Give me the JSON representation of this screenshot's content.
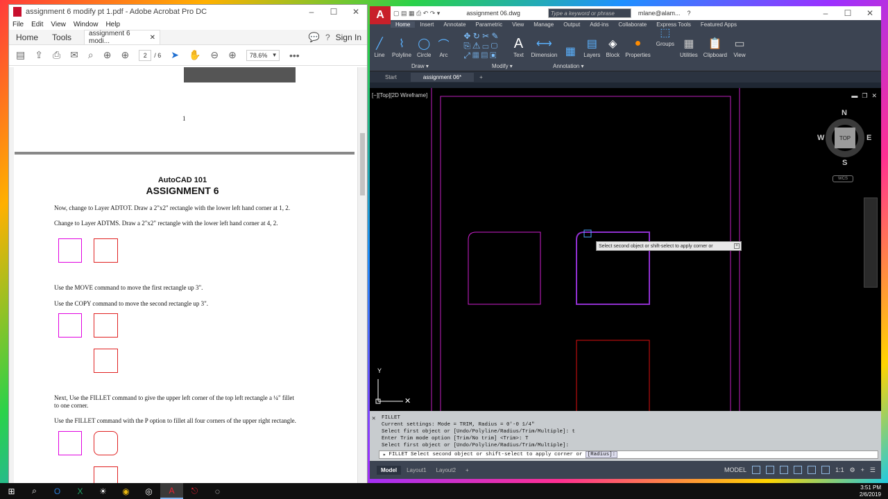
{
  "acrobat": {
    "title": "assignment 6 modify pt 1.pdf - Adobe Acrobat Pro DC",
    "menu": [
      "File",
      "Edit",
      "View",
      "Window",
      "Help"
    ],
    "tabs": {
      "home": "Home",
      "tools": "Tools",
      "doc": "assignment 6 modi...",
      "sign_in": "Sign In"
    },
    "toolbar": {
      "page_current": "2",
      "page_total": "/ 6",
      "zoom": "78.6%"
    },
    "page_number_prev": "1",
    "doc": {
      "heading1": "AutoCAD 101",
      "heading2": "ASSIGNMENT 6",
      "p1": "Now, change to Layer ADTOT. Draw a 2\"x2\" rectangle with the lower left hand corner at 1, 2.",
      "p2": "Change to Layer ADTMS. Draw a 2\"x2\" rectangle with the lower left hand corner at 4, 2.",
      "p3": "Use the MOVE command to move the first rectangle up 3\".",
      "p4": "Use the COPY command to move the second rectangle up 3\".",
      "p5a": "Next, Use the FILLET command to give the upper left corner of the top left rectangle a ¼\" fillet",
      "p5b": "to one corner.",
      "p6": "Use the FILLET command with the P option to fillet all four corners of the upper right rectangle."
    },
    "colors": {
      "magenta": "#e000e0",
      "red": "#e02020"
    }
  },
  "autocad": {
    "title": "assignment 06.dwg",
    "search_placeholder": "Type a keyword or phrase",
    "user": "mlane@alam...",
    "ribbon_tabs": [
      "Home",
      "Insert",
      "Annotate",
      "Parametric",
      "View",
      "Manage",
      "Output",
      "Add-ins",
      "Collaborate",
      "Express Tools",
      "Featured Apps"
    ],
    "tools": {
      "line": "Line",
      "polyline": "Polyline",
      "circle": "Circle",
      "arc": "Arc",
      "text": "Text",
      "dimension": "Dimension",
      "layers": "Layers",
      "block": "Block",
      "properties": "Properties",
      "groups": "Groups",
      "utilities": "Utilities",
      "clipboard": "Clipboard",
      "view": "View"
    },
    "panels": {
      "draw": "Draw ▾",
      "modify": "Modify ▾",
      "annotation": "Annotation ▾"
    },
    "file_tabs": {
      "start": "Start",
      "doc": "assignment 06*"
    },
    "viewport_label": "[−][Top][2D Wireframe]",
    "viewcube": {
      "n": "N",
      "s": "S",
      "e": "E",
      "w": "W",
      "top": "TOP",
      "wcs": "WCS"
    },
    "ucs": {
      "y": "Y"
    },
    "tooltip": "Select second object or shift-select to apply corner or",
    "command_history": [
      "FILLET",
      "Current settings: Mode = TRIM, Radius = 0'-0 1/4\"",
      "Select first object or [Undo/Polyline/Radius/Trim/Multiple]: t",
      "Enter Trim mode option [Trim/No trim] <Trim>: T",
      "Select first object or [Undo/Polyline/Radius/Trim/Multiple]:"
    ],
    "command_prompt": "FILLET Select second object or shift-select to apply corner or",
    "command_option": "[Radius]:",
    "layout_tabs": [
      "Model",
      "Layout1",
      "Layout2"
    ],
    "status_model": "MODEL",
    "status_scale": "1:1"
  },
  "taskbar": {
    "time": "3:51 PM",
    "date": "2/6/2019"
  }
}
